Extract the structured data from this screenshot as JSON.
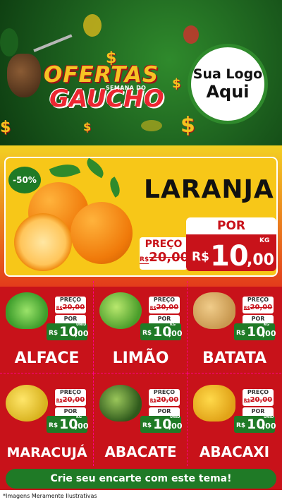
{
  "header": {
    "title_line1": "OFERTAS",
    "title_small": "SEMANA DO",
    "title_line2": "GAUCHO",
    "logo_line1": "Sua Logo",
    "logo_line2": "Aqui",
    "currency_symbol": "$"
  },
  "hero": {
    "discount": "-50%",
    "product": "LARANJA",
    "preco_label": "PREÇO",
    "old_currency": "R$",
    "old_price": "20,00",
    "por_label": "POR",
    "currency": "R$",
    "price_int": "10",
    "price_dec": ",00",
    "unit": "KG"
  },
  "products": [
    {
      "name": "ALFACE",
      "preco_label": "PREÇO",
      "old_currency": "R$",
      "old_price": "20,00",
      "por_label": "POR",
      "currency": "R$",
      "price_int": "10",
      "price_dec": ",00",
      "unit": "UNID"
    },
    {
      "name": "LIMÃO",
      "preco_label": "PREÇO",
      "old_currency": "R$",
      "old_price": "20,00",
      "por_label": "POR",
      "currency": "R$",
      "price_int": "10",
      "price_dec": ",00",
      "unit": "KG"
    },
    {
      "name": "BATATA",
      "preco_label": "PREÇO",
      "old_currency": "R$",
      "old_price": "20,00",
      "por_label": "POR",
      "currency": "R$",
      "price_int": "10",
      "price_dec": ",00",
      "unit": "KG"
    },
    {
      "name": "MARACUJÁ",
      "preco_label": "PREÇO",
      "old_currency": "R$",
      "old_price": "20,00",
      "por_label": "POR",
      "currency": "R$",
      "price_int": "10",
      "price_dec": ",00",
      "unit": "KG"
    },
    {
      "name": "ABACATE",
      "preco_label": "PREÇO",
      "old_currency": "R$",
      "old_price": "20,00",
      "por_label": "POR",
      "currency": "R$",
      "price_int": "10",
      "price_dec": ",00",
      "unit": "UNID"
    },
    {
      "name": "ABACAXI",
      "preco_label": "PREÇO",
      "old_currency": "R$",
      "old_price": "20,00",
      "por_label": "POR",
      "currency": "R$",
      "price_int": "10",
      "price_dec": ",00",
      "unit": "UNID"
    }
  ],
  "footer": {
    "cta": "Crie seu encarte com este tema!",
    "disclaimer": "*Imagens Meramente Ilustrativas"
  },
  "colors": {
    "red": "#c8121a",
    "green": "#1f7a26",
    "yellow": "#f7c718"
  }
}
